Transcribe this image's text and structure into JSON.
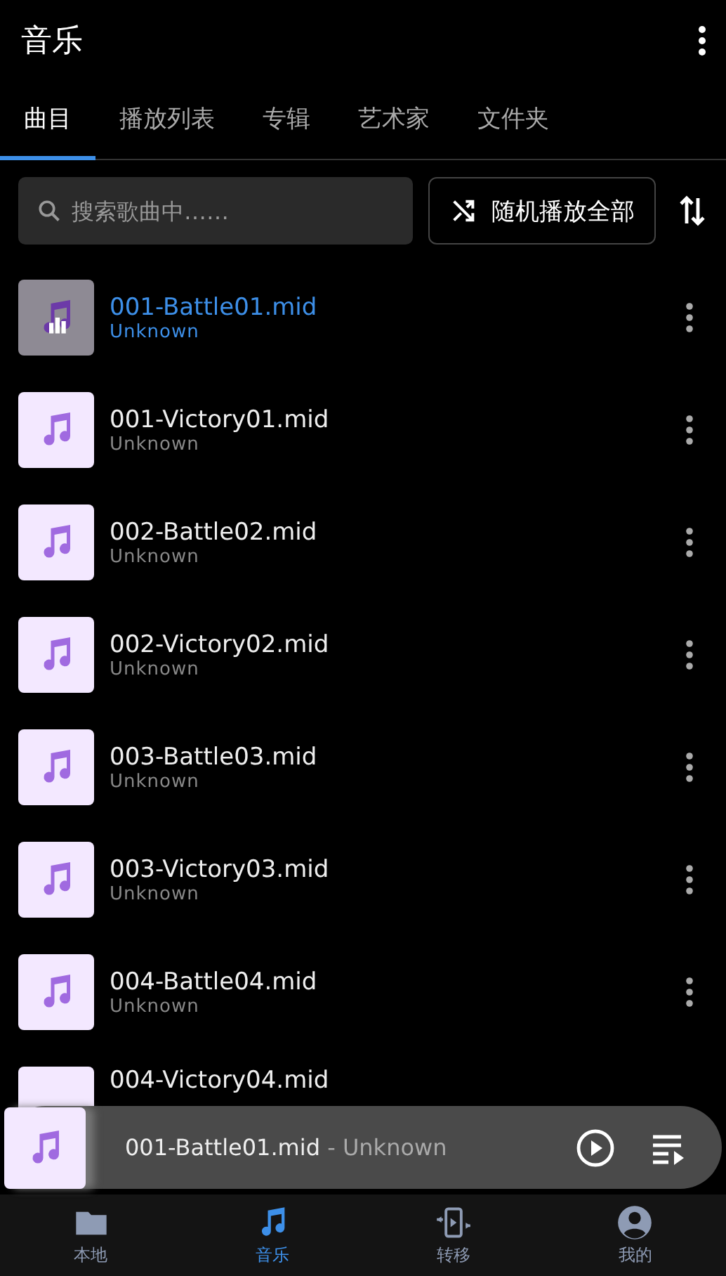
{
  "header": {
    "title": "音乐"
  },
  "tabs": [
    {
      "label": "曲目",
      "selected": true
    },
    {
      "label": "播放列表",
      "selected": false
    },
    {
      "label": "专辑",
      "selected": false
    },
    {
      "label": "艺术家",
      "selected": false
    },
    {
      "label": "文件夹",
      "selected": false
    }
  ],
  "search": {
    "placeholder": "搜索歌曲中……"
  },
  "shuffle_button": "随机播放全部",
  "songs": [
    {
      "title": "001-Battle01.mid",
      "artist": "Unknown",
      "selected": true
    },
    {
      "title": "001-Victory01.mid",
      "artist": "Unknown",
      "selected": false
    },
    {
      "title": "002-Battle02.mid",
      "artist": "Unknown",
      "selected": false
    },
    {
      "title": "002-Victory02.mid",
      "artist": "Unknown",
      "selected": false
    },
    {
      "title": "003-Battle03.mid",
      "artist": "Unknown",
      "selected": false
    },
    {
      "title": "003-Victory03.mid",
      "artist": "Unknown",
      "selected": false
    },
    {
      "title": "004-Battle04.mid",
      "artist": "Unknown",
      "selected": false
    },
    {
      "title": "004-Victory04.mid",
      "selected": false
    }
  ],
  "now_playing": {
    "title": "001-Battle01.mid",
    "artist": "- Unknown"
  },
  "bottom_nav": [
    {
      "label": "本地",
      "kind": "folder",
      "selected": false
    },
    {
      "label": "音乐",
      "kind": "music",
      "selected": true
    },
    {
      "label": "转移",
      "kind": "transfer",
      "selected": false
    },
    {
      "label": "我的",
      "kind": "profile",
      "selected": false
    }
  ]
}
